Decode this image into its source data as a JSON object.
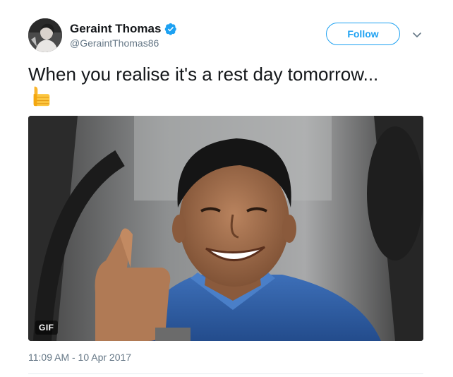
{
  "tweet": {
    "author": {
      "display_name": "Geraint Thomas",
      "handle": "@GeraintThomas86",
      "verified": true
    },
    "follow_label": "Follow",
    "text": "When you realise it's a rest day tomorrow...",
    "emoji": "thumbs-up-icon",
    "media": {
      "type": "gif",
      "badge": "GIF"
    },
    "timestamp": "11:09 AM - 10 Apr 2017"
  },
  "colors": {
    "accent": "#1da1f2",
    "secondary_text": "#657786",
    "primary_text": "#14171a",
    "divider": "#e6ecf0"
  }
}
